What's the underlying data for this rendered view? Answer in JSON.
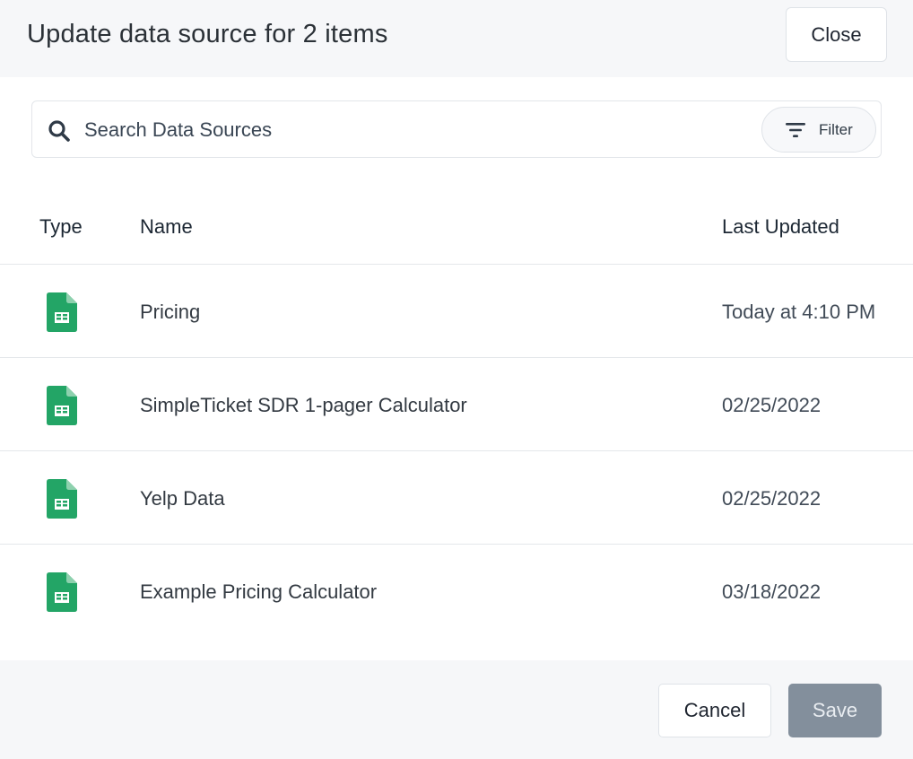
{
  "header": {
    "title": "Update data source for 2 items",
    "close_label": "Close"
  },
  "search": {
    "placeholder": "Search Data Sources",
    "value": "",
    "filter_label": "Filter",
    "search_icon": "search-icon",
    "filter_icon": "filter-icon"
  },
  "table": {
    "headers": {
      "type": "Type",
      "name": "Name",
      "last_updated": "Last Updated"
    },
    "rows": [
      {
        "type_icon": "google-sheets-icon",
        "name": "Pricing",
        "last_updated": "Today at 4:10 PM"
      },
      {
        "type_icon": "google-sheets-icon",
        "name": "SimpleTicket SDR 1-pager Calculator",
        "last_updated": "02/25/2022"
      },
      {
        "type_icon": "google-sheets-icon",
        "name": "Yelp Data",
        "last_updated": "02/25/2022"
      },
      {
        "type_icon": "google-sheets-icon",
        "name": "Example Pricing Calculator",
        "last_updated": "03/18/2022"
      }
    ]
  },
  "footer": {
    "cancel_label": "Cancel",
    "save_label": "Save",
    "save_disabled": true
  },
  "colors": {
    "sheets_green": "#23a566",
    "sheets_fold": "#8ed1ae",
    "header_bg": "#f6f7f9",
    "save_disabled_bg": "#838f9c"
  }
}
